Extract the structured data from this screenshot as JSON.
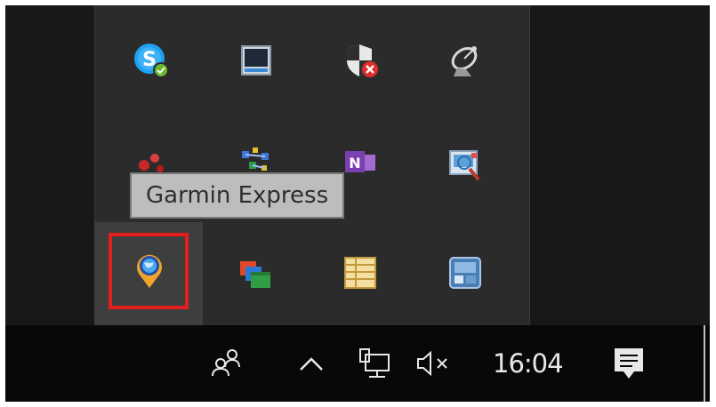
{
  "tooltip": {
    "text": "Garmin Express"
  },
  "tray_flyout": {
    "icons": [
      {
        "name": "skype-icon"
      },
      {
        "name": "window-app-icon"
      },
      {
        "name": "security-shield-error-icon"
      },
      {
        "name": "satellite-dish-icon"
      },
      {
        "name": "red-app-icon"
      },
      {
        "name": "network-dots-icon"
      },
      {
        "name": "onenote-icon"
      },
      {
        "name": "image-search-icon"
      },
      {
        "name": "garmin-express-icon"
      },
      {
        "name": "multi-window-icon"
      },
      {
        "name": "spreadsheet-icon"
      },
      {
        "name": "blue-app-icon"
      }
    ]
  },
  "taskbar": {
    "clock": "16:04",
    "icons": [
      "people-icon",
      "chevron-up-icon",
      "network-icon",
      "volume-muted-icon",
      "action-center-icon"
    ]
  },
  "colors": {
    "highlight": "#e3201b",
    "taskbar": "#080808",
    "flyout": "#2b2b2b",
    "tooltip_bg": "#bdbdbd"
  }
}
